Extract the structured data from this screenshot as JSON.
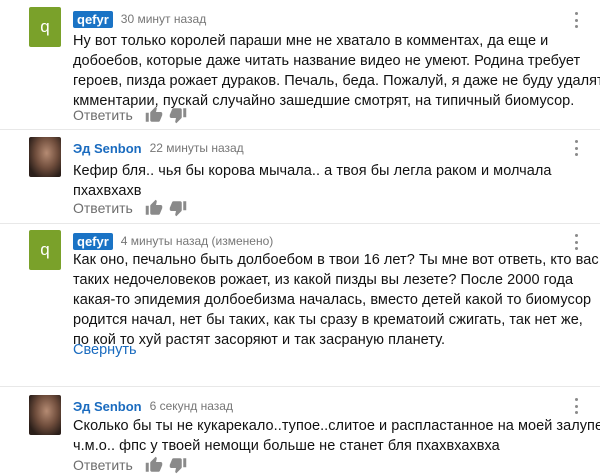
{
  "comments": [
    {
      "author": "qefyr",
      "avatar_letter": "q",
      "time": "30 минут назад",
      "lines": [
        "Ну вот только королей параши мне не хватало в комментах, да еще и",
        "добоебов, которые даже читать название видео не умеют. Родина требует",
        "героев, пизда рожает дураков. Печаль, беда. Пожалуй, я даже не буду удалять",
        "кмментарии, пускай случайно зашедшие смотрят, на типичный биомусор."
      ],
      "reply_label": "Ответить"
    },
    {
      "author": "Эд Senbon",
      "time": "22 минуты назад",
      "lines": [
        "Кефир бля.. чья бы корова мычала.. а твоя бы легла раком и молчала",
        "пхахвхахв"
      ],
      "reply_label": "Ответить"
    },
    {
      "author": "qefyr",
      "avatar_letter": "q",
      "time": "4 минуты назад (изменено)",
      "lines": [
        "Как оно, печально быть долбоебом в твои 16 лет? Ты мне вот ответь, кто вас",
        "таких недочеловеков рожает, из какой пизды вы лезете? После 2000 года",
        "какая-то эпидемия долбоебизма началась, вместо детей какой то биомусор",
        "родится начал, нет бы таких, как ты сразу в крематоий сжигать, так нет же,",
        "по кой то хуй растят засоряют и так засраную планету."
      ],
      "collapse_label": "Свернуть"
    },
    {
      "author": "Эд Senbon",
      "time": "6 секунд назад",
      "lines": [
        "Сколько бы ты не кукарекало..тупое..слитое и распластанное на моей залупе",
        "ч.м.о.. фпс у твоей немощи больше не станет бля пхахвхахвха"
      ],
      "reply_label": "Ответить"
    }
  ],
  "icons": {
    "like": "thumbs-up-icon",
    "dislike": "thumbs-down-icon",
    "menu": "more-vert-icon"
  },
  "colors": {
    "author_badge": "#1a73c5",
    "link": "#1a6bbf",
    "letter_avatar": "#7aa12a"
  }
}
